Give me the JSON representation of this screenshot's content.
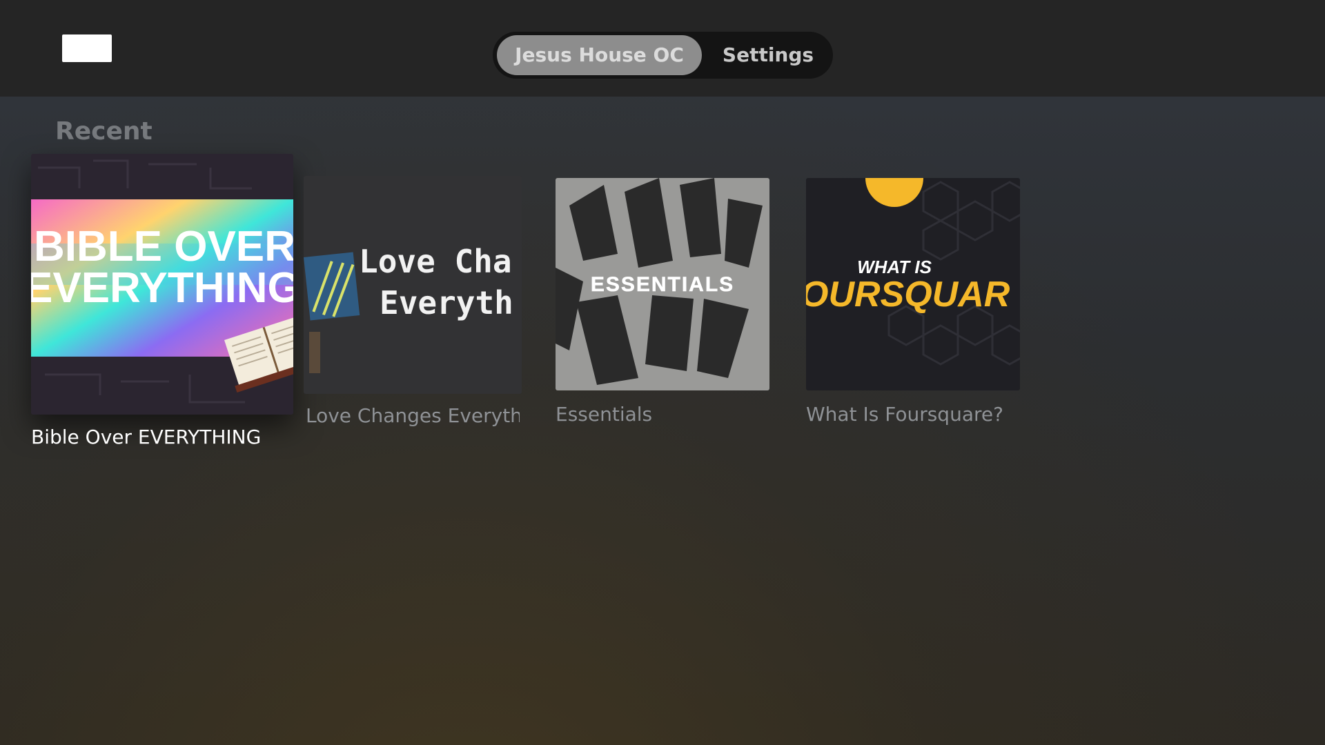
{
  "header": {
    "logo": "app-logo",
    "tabs": [
      {
        "label": "Jesus House OC",
        "selected": true
      },
      {
        "label": "Settings",
        "selected": false
      }
    ]
  },
  "recent": {
    "title": "Recent",
    "items": [
      {
        "title": "Bible Over EVERYTHING",
        "art_text_1": "BIBLE OVER",
        "art_text_2": "EVERYTHING",
        "focused": true
      },
      {
        "title": "Love Changes Everyth",
        "art_text_1": "Love Cha",
        "art_text_2": "Everyth",
        "focused": false
      },
      {
        "title": "Essentials",
        "art_text_1": "ESSENTIALS",
        "focused": false
      },
      {
        "title": "What Is Foursquare?",
        "art_text_1": "WHAT IS",
        "art_text_2": "OURSQUAR",
        "focused": false
      }
    ]
  },
  "colors": {
    "accent_yellow": "#f5b82a",
    "tab_selected": "#8d8d8d"
  }
}
